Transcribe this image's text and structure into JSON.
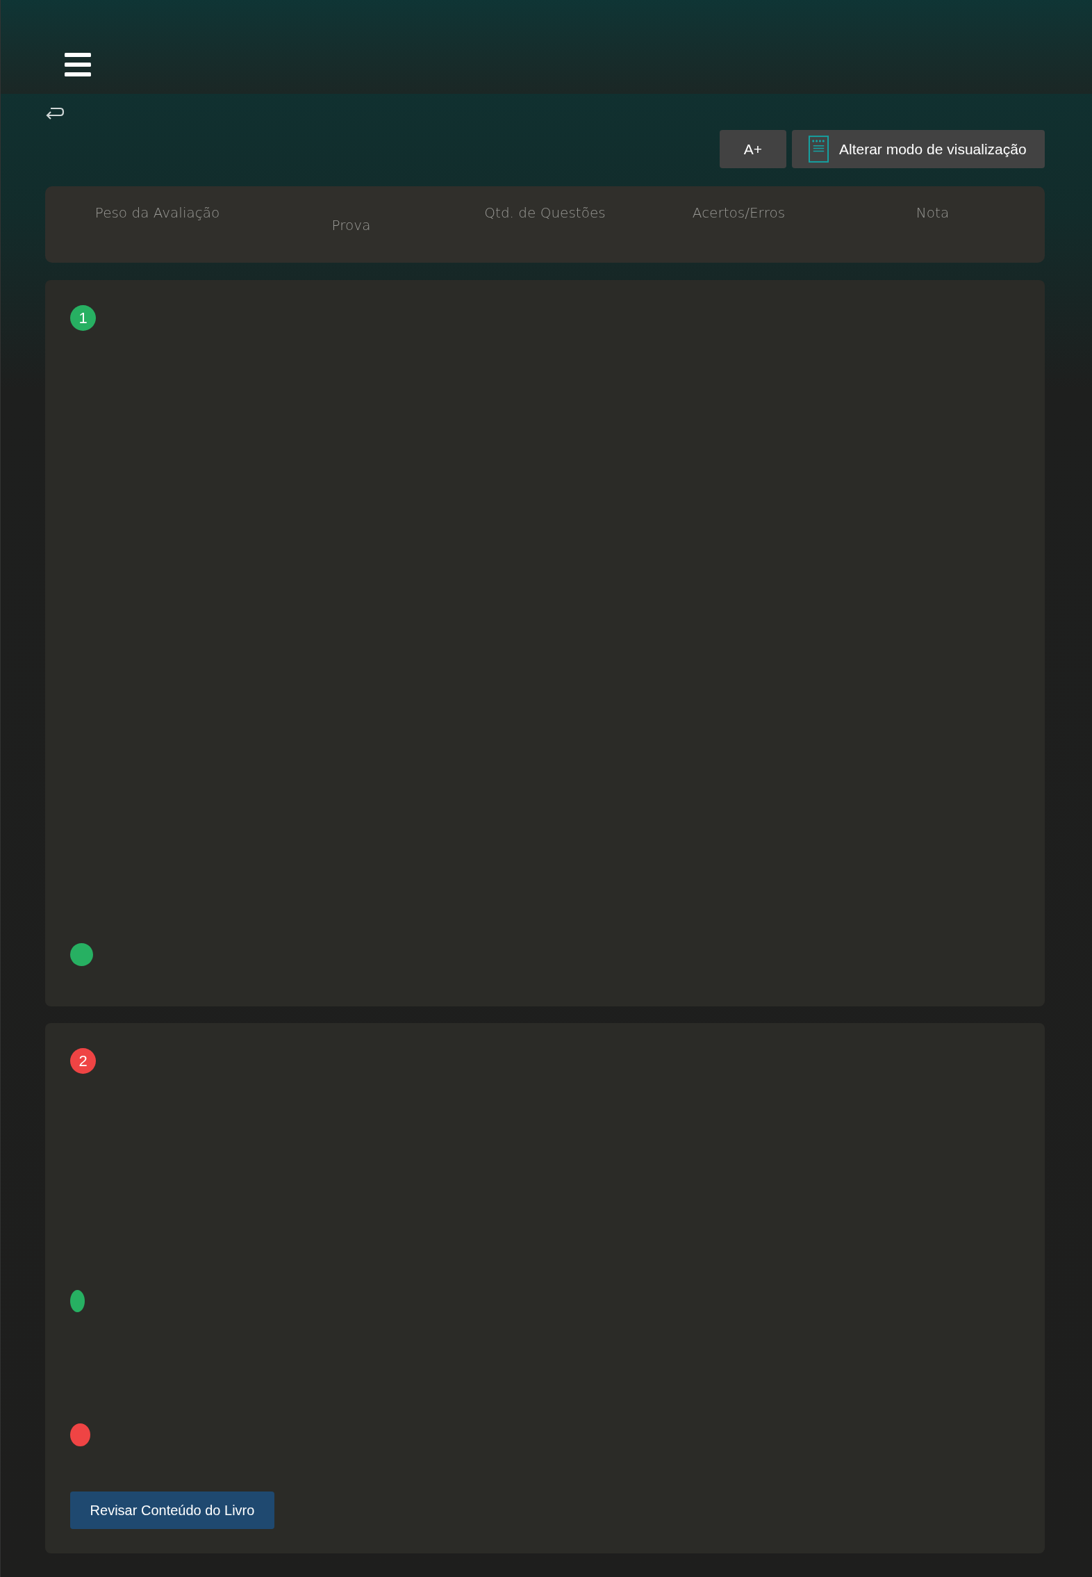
{
  "toolbar": {
    "font_button": "A+",
    "view_button": "Alterar modo de visualização"
  },
  "summary": {
    "columns": [
      {
        "label": "Peso da Avaliação",
        "lowered": false
      },
      {
        "label": "Prova",
        "lowered": true
      },
      {
        "label": "Qtd. de Questões",
        "lowered": false
      },
      {
        "label": "Acertos/Erros",
        "lowered": false
      },
      {
        "label": "Nota",
        "lowered": false
      }
    ]
  },
  "questions": [
    {
      "number": "1",
      "color": "#27b062",
      "marks": [
        {
          "color": "#27b062",
          "kind": "round"
        }
      ]
    },
    {
      "number": "2",
      "color": "#ef4444",
      "marks": [
        {
          "color": "#27b062",
          "kind": "oval"
        },
        {
          "color": "#ef4444",
          "kind": "round"
        }
      ],
      "review_button": "Revisar Conteúdo do Livro"
    }
  ]
}
